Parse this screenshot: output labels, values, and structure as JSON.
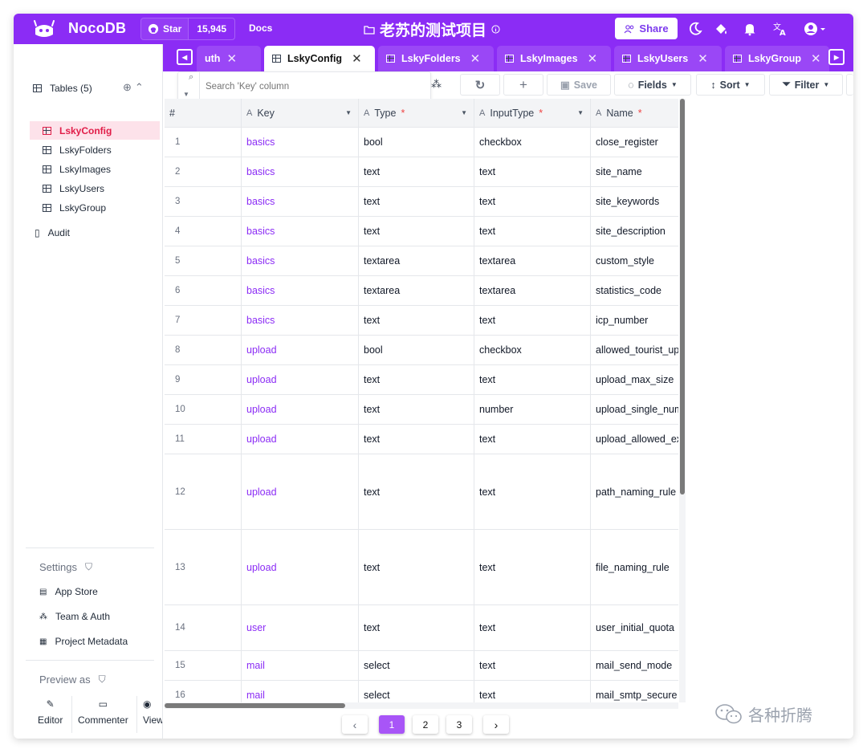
{
  "topbar": {
    "brand": "NocoDB",
    "github_star": "Star",
    "github_count": "15,945",
    "docs": "Docs",
    "project_title": "老苏的测试项目",
    "share": "Share"
  },
  "tabs": [
    {
      "label": "uth",
      "active": false
    },
    {
      "label": "LskyConfig",
      "active": true
    },
    {
      "label": "LskyFolders",
      "active": false
    },
    {
      "label": "LskyImages",
      "active": false
    },
    {
      "label": "LskyUsers",
      "active": false
    },
    {
      "label": "LskyGroup",
      "active": false
    }
  ],
  "sidebar": {
    "tables_header": "Tables (5)",
    "tables": [
      "LskyConfig",
      "LskyFolders",
      "LskyImages",
      "LskyUsers",
      "LskyGroup"
    ],
    "audit": "Audit",
    "settings": "Settings",
    "app_store": "App Store",
    "team_auth": "Team & Auth",
    "project_metadata": "Project Metadata",
    "preview_as": "Preview as",
    "roles": [
      "Editor",
      "Commenter",
      "View"
    ]
  },
  "toolbar": {
    "search_placeholder": "Search 'Key' column",
    "save": "Save",
    "fields": "Fields",
    "sort": "Sort",
    "filter": "Filter"
  },
  "grid": {
    "columns": [
      {
        "label": "#",
        "required": false
      },
      {
        "label": "Key",
        "required": false
      },
      {
        "label": "Type",
        "required": true,
        "mark": "*"
      },
      {
        "label": "InputType",
        "required": true,
        "mark": "*"
      },
      {
        "label": "Name",
        "required": true,
        "mark": "*"
      }
    ],
    "rows": [
      {
        "n": "1",
        "key": "basics",
        "type": "bool",
        "input": "checkbox",
        "name": "close_register"
      },
      {
        "n": "2",
        "key": "basics",
        "type": "text",
        "input": "text",
        "name": "site_name"
      },
      {
        "n": "3",
        "key": "basics",
        "type": "text",
        "input": "text",
        "name": "site_keywords"
      },
      {
        "n": "4",
        "key": "basics",
        "type": "text",
        "input": "text",
        "name": "site_description"
      },
      {
        "n": "5",
        "key": "basics",
        "type": "textarea",
        "input": "textarea",
        "name": "custom_style"
      },
      {
        "n": "6",
        "key": "basics",
        "type": "textarea",
        "input": "textarea",
        "name": "statistics_code"
      },
      {
        "n": "7",
        "key": "basics",
        "type": "text",
        "input": "text",
        "name": "icp_number"
      },
      {
        "n": "8",
        "key": "upload",
        "type": "bool",
        "input": "checkbox",
        "name": "allowed_tourist_up"
      },
      {
        "n": "9",
        "key": "upload",
        "type": "text",
        "input": "text",
        "name": "upload_max_size"
      },
      {
        "n": "10",
        "key": "upload",
        "type": "text",
        "input": "number",
        "name": "upload_single_num"
      },
      {
        "n": "11",
        "key": "upload",
        "type": "text",
        "input": "text",
        "name": "upload_allowed_ex"
      },
      {
        "n": "12",
        "key": "upload",
        "type": "text",
        "input": "text",
        "name": "path_naming_rule"
      },
      {
        "n": "13",
        "key": "upload",
        "type": "text",
        "input": "text",
        "name": "file_naming_rule"
      },
      {
        "n": "14",
        "key": "user",
        "type": "text",
        "input": "text",
        "name": "user_initial_quota"
      },
      {
        "n": "15",
        "key": "mail",
        "type": "select",
        "input": "text",
        "name": "mail_send_mode"
      },
      {
        "n": "16",
        "key": "mail",
        "type": "select",
        "input": "text",
        "name": "mail_smtp_secure"
      }
    ]
  },
  "pagination": {
    "pages": [
      "1",
      "2",
      "3"
    ],
    "current": "1"
  },
  "watermark": "各种折腾",
  "colors": {
    "brand": "#8b2cf5",
    "active_row": "#fde2ea",
    "key_text": "#8b2cf5"
  }
}
